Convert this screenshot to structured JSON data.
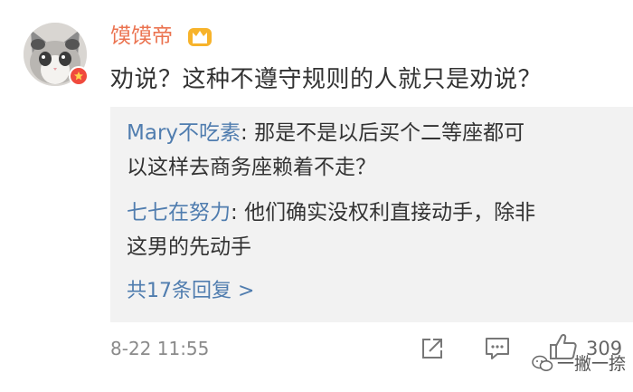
{
  "post": {
    "username": "馍馍帝",
    "text": "劝说？这种不遵守规则的人就只是劝说？",
    "time": "8-22 11:55",
    "like_count": "309"
  },
  "replies": [
    {
      "author": "Mary不吃素",
      "text": "那是不是以后买个二等座都可",
      "text2": "以这样去商务座赖着不走？"
    },
    {
      "author": "七七在努力",
      "text": "他们确实没权利直接动手，除非",
      "text2": "这男的先动手"
    }
  ],
  "more_replies": "共17条回复 >",
  "watermark": "一撇一捺",
  "colors": {
    "username": "#eb7350",
    "link": "#507daf",
    "badge": "#f04a3d",
    "reply_bg": "#f2f2f2"
  },
  "icons": [
    "cat-avatar",
    "verified-badge-icon",
    "crown-icon",
    "share-icon",
    "comment-icon",
    "like-icon",
    "wechat-icon"
  ]
}
